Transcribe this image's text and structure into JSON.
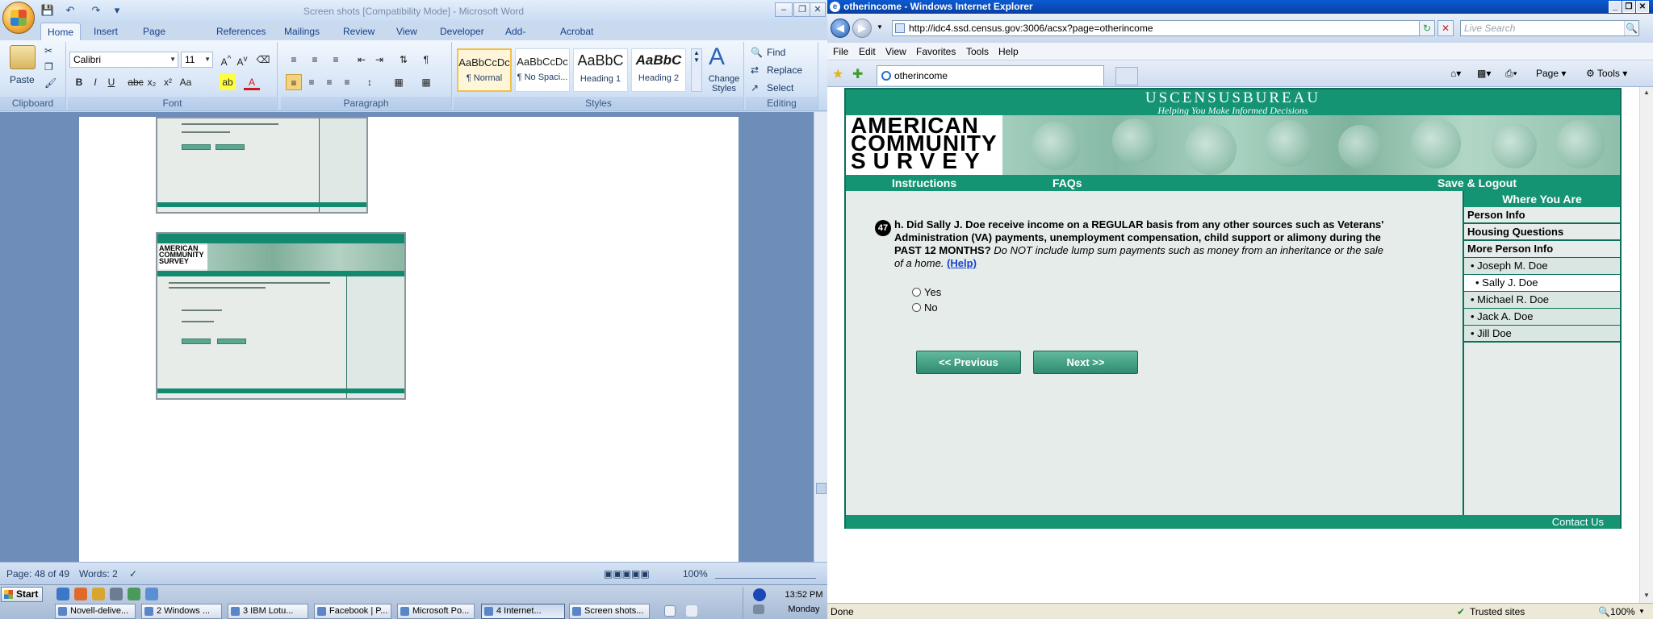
{
  "word": {
    "title": "Screen shots [Compatibility Mode] - Microsoft Word",
    "tabs": [
      "Home",
      "Insert",
      "Page Layout",
      "References",
      "Mailings",
      "Review",
      "View",
      "Developer",
      "Add-Ins",
      "Acrobat"
    ],
    "clipboard": {
      "paste": "Paste",
      "label": "Clipboard"
    },
    "font": {
      "name": "Calibri",
      "size": "11",
      "label": "Font"
    },
    "paragraph_label": "Paragraph",
    "styles": [
      {
        "preview": "AaBbCcDc",
        "name": "¶ Normal"
      },
      {
        "preview": "AaBbCcDc",
        "name": "¶ No Spaci..."
      },
      {
        "preview": "AaBbC",
        "name": "Heading 1"
      },
      {
        "preview": "AaBbC",
        "name": "Heading 2"
      }
    ],
    "change_styles": "Change Styles",
    "styles_label": "Styles",
    "editing": {
      "find": "Find",
      "replace": "Replace",
      "select": "Select",
      "label": "Editing"
    },
    "status": {
      "page": "Page: 48 of 49",
      "words": "Words: 2",
      "zoom": "100%"
    }
  },
  "ie": {
    "title": "otherincome - Windows Internet Explorer",
    "url": "http://idc4.ssd.census.gov:3006/acsx?page=otherincome",
    "search_placeholder": "Live Search",
    "menu": [
      "File",
      "Edit",
      "View",
      "Favorites",
      "Tools",
      "Help"
    ],
    "tab_title": "otherincome",
    "commands": {
      "page": "Page",
      "tools": "Tools"
    },
    "status_left": "Done",
    "status_zone": "Trusted sites",
    "status_zoom": "100%"
  },
  "census": {
    "bureau": "USCENSUSBUREAU",
    "tagline": "Helping You Make Informed Decisions",
    "logo": [
      "AMERICAN",
      "COMMUNITY",
      "SURVEY"
    ],
    "nav": {
      "instructions": "Instructions",
      "faqs": "FAQs",
      "logout": "Save & Logout"
    },
    "question_number": "47",
    "question_bold": "h. Did Sally J. Doe receive income on a REGULAR basis from any other sources such as Veterans' Administration (VA) payments, unemployment compensation, child support or alimony during the PAST 12 MONTHS?",
    "question_italic": "Do NOT include lump sum payments such as money from an inheritance or the sale of a home.",
    "help": "(Help)",
    "options": [
      "Yes",
      "No"
    ],
    "prev": "<<   Previous",
    "next": "Next   >>",
    "sidebar": {
      "heading": "Where You Are",
      "sections": [
        "Person Info",
        "Housing Questions",
        "More Person Info"
      ],
      "people": [
        "• Joseph M. Doe",
        "• Sally J. Doe",
        "• Michael R. Doe",
        "• Jack A. Doe",
        "• Jill Doe"
      ]
    },
    "contact": "Contact Us"
  },
  "taskbar": {
    "start": "Start",
    "tasks": [
      "Novell-delive...",
      "2 Windows ...",
      "3 IBM Lotu...",
      "Facebook | P...",
      "Microsoft Po...",
      "4 Internet...",
      "Screen shots..."
    ],
    "time": "13:52 PM",
    "day": "Monday"
  }
}
